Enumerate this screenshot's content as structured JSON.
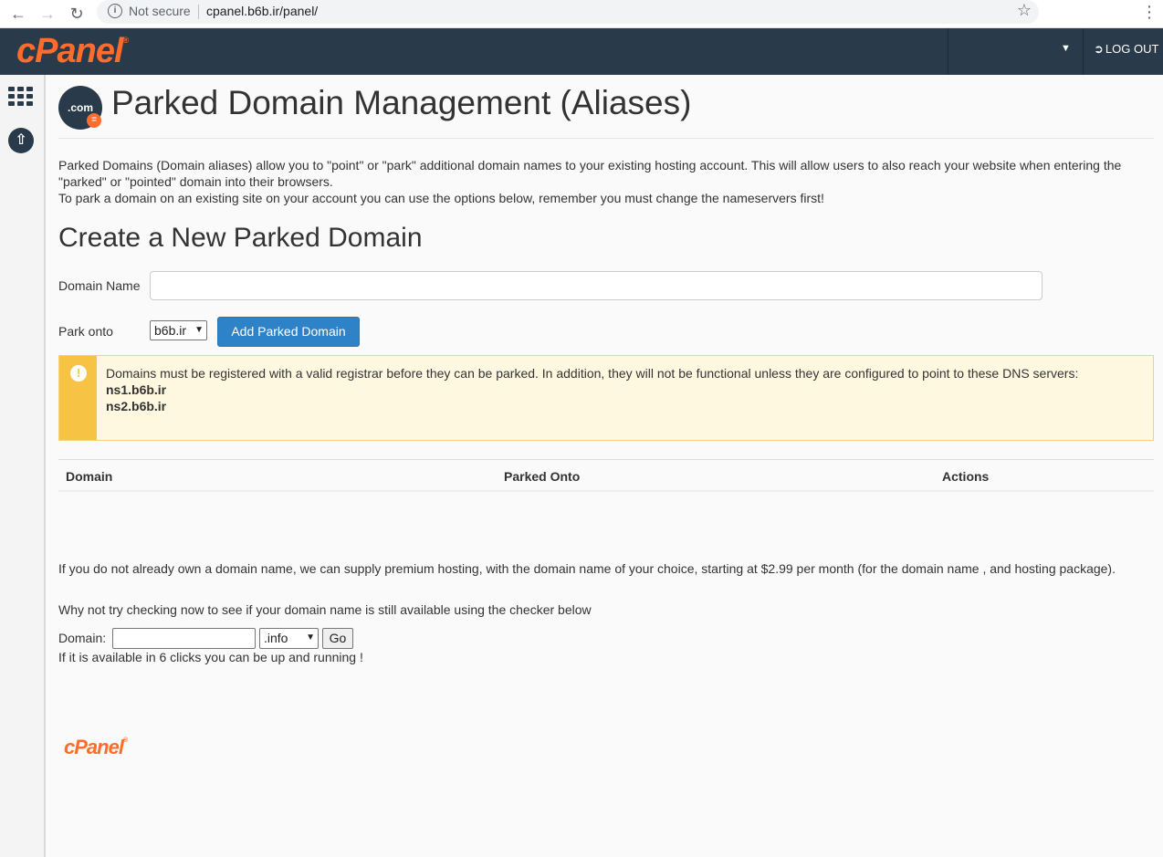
{
  "browser": {
    "security_label": "Not secure",
    "url": "cpanel.b6b.ir/panel/"
  },
  "header": {
    "logo_text": "cPanel",
    "logout_label": "LOG OUT"
  },
  "page": {
    "icon_text": ".com",
    "title": "Parked Domain Management (Aliases)",
    "intro_line1": "Parked Domains (Domain aliases) allow you to \"point\" or \"park\" additional domain names to your existing hosting account. This will allow users to also reach your website when entering the \"parked\" or \"pointed\" domain into their browsers.",
    "intro_line2": "To park a domain on an existing site on your account you can use the options below, remember you must change the nameservers first!"
  },
  "create_form": {
    "section_title": "Create a New Parked Domain",
    "domain_label": "Domain Name",
    "domain_value": "",
    "park_onto_label": "Park onto",
    "park_onto_selected": "b6b.ir",
    "add_button": "Add Parked Domain"
  },
  "alert": {
    "message": "Domains must be registered with a valid registrar before they can be parked. In addition, they will not be functional unless they are configured to point to these DNS servers:",
    "ns1": "ns1.b6b.ir",
    "ns2": "ns2.b6b.ir"
  },
  "table": {
    "columns": [
      "Domain",
      "Parked Onto",
      "Actions"
    ],
    "rows": []
  },
  "promo": {
    "line1": "If you do not already own a domain name, we can supply premium hosting, with the domain name of your choice, starting at $2.99 per month (for the domain name , and hosting package).",
    "line2": "Why not try checking now to see if your domain name is still available using the checker below",
    "domain_label": "Domain:",
    "domain_value": "",
    "tld_selected": ".info",
    "go_label": "Go",
    "line3": "If it is available in 6 clicks you can be up and running !"
  },
  "footer": {
    "logo_text": "cPanel"
  },
  "colors": {
    "topbar": "#293a4a",
    "brand_orange": "#ff6c2c",
    "primary_button": "#2e83c8",
    "alert_bg": "#fff8e1",
    "alert_stripe": "#f6c344"
  }
}
